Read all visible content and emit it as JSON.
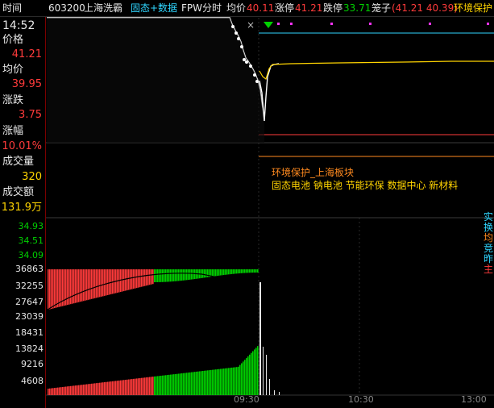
{
  "header": {
    "time_tab": "时间",
    "stock_code": "603200",
    "stock_name": "上海洗霸",
    "mode_label": "固态+数据",
    "chart_mode": "FPW分时",
    "avg_label": "均价",
    "avg_value": "40.11",
    "limit_up_label": "涨停",
    "limit_up_value": "41.21",
    "limit_down_label": "跌停",
    "limit_down_value": "33.71",
    "bid_ask_label": "笼子",
    "bid_ask_value": "(41.21 40.39)",
    "concept_label": "环境保护"
  },
  "quote_panel": {
    "time": "14:52",
    "price_label": "价格",
    "price_value": "41.21",
    "avg_label": "均价",
    "avg_value": "39.95",
    "change_label": "涨跌",
    "change_value": "3.75",
    "pct_label": "涨幅",
    "pct_value": "10.01%",
    "volume_label": "成交量",
    "volume_value": "320",
    "amount_label": "成交额",
    "amount_value": "131.9万"
  },
  "price_ticks": [
    "34.93",
    "34.51",
    "34.09"
  ],
  "volume_ticks": [
    "36863",
    "32255",
    "27647",
    "23039",
    "18431",
    "13824",
    "9216",
    "4608"
  ],
  "time_labels": [
    "09:30",
    "10:30",
    "13:00"
  ],
  "concept_tags": {
    "line1": "环境保护_上海板块",
    "line2": "固态电池  钠电池  节能环保  数据中心  新材料"
  },
  "side_labels": [
    "实",
    "换",
    "均",
    "竞",
    "昨",
    "主"
  ],
  "close_glyph": "×",
  "colors": {
    "up": "#ff3b3b",
    "down": "#00d000",
    "cyan": "#2fd6ff",
    "yellow": "#ffd400",
    "orange": "#ff8a1f",
    "magenta": "#ff33ff"
  },
  "chart_data": {
    "type": "line",
    "title": "",
    "xlabel": "",
    "ylabel": "",
    "x": [
      "09:30",
      "10:30",
      "13:00"
    ],
    "series": [
      {
        "values": [
          34.09,
          39.95,
          41.21
        ]
      },
      {
        "values": [
          36863,
          13824,
          4608
        ]
      }
    ]
  }
}
